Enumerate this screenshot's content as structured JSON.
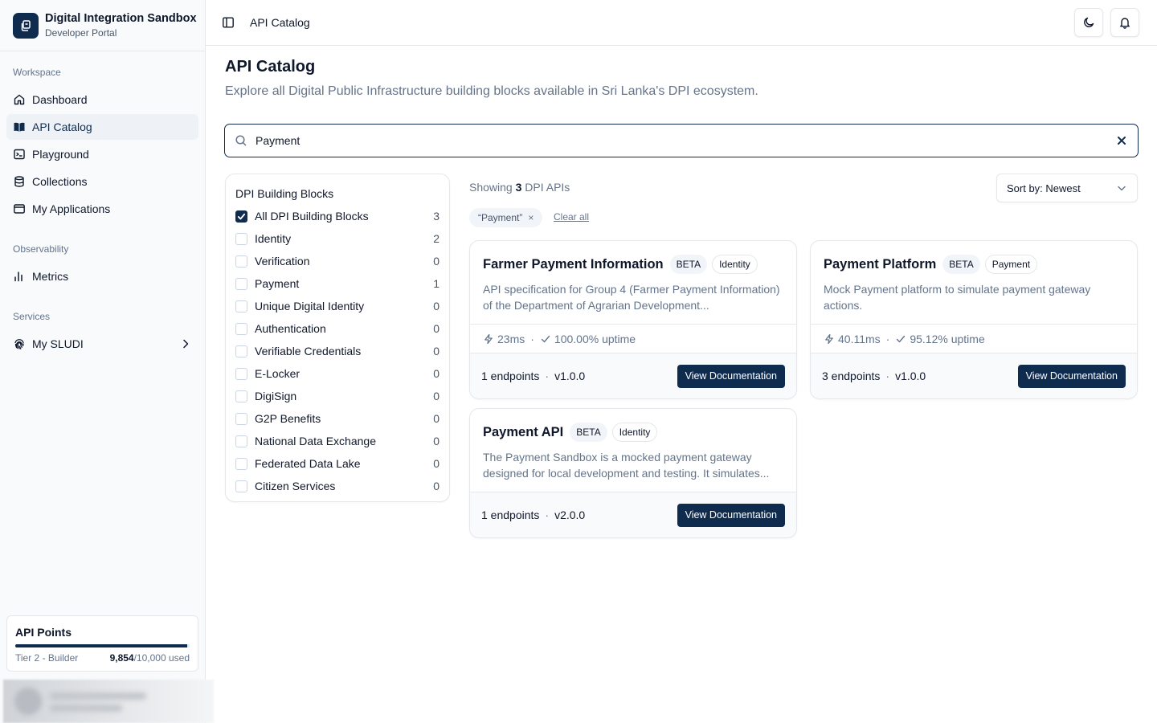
{
  "brand": {
    "title": "Digital Integration Sandbox",
    "subtitle": "Developer Portal"
  },
  "sidebar": {
    "groups": [
      {
        "label": "Workspace",
        "items": [
          {
            "label": "Dashboard",
            "icon": "home-icon"
          },
          {
            "label": "API Catalog",
            "icon": "book-icon",
            "active": true
          },
          {
            "label": "Playground",
            "icon": "terminal-icon"
          },
          {
            "label": "Collections",
            "icon": "database-icon"
          },
          {
            "label": "My Applications",
            "icon": "app-window-icon"
          }
        ]
      },
      {
        "label": "Observability",
        "items": [
          {
            "label": "Metrics",
            "icon": "bar-chart-icon"
          }
        ]
      },
      {
        "label": "Services",
        "items": [
          {
            "label": "My SLUDI",
            "icon": "fingerprint-icon"
          }
        ]
      }
    ],
    "points": {
      "title": "API Points",
      "tier": "Tier 2 - Builder",
      "used": "9,854",
      "total": "/10,000 used",
      "fraction": 0.9854
    }
  },
  "header": {
    "breadcrumb": "API Catalog"
  },
  "main": {
    "title": "API Catalog",
    "description": "Explore all Digital Public Infrastructure building blocks available in Sri Lanka's DPI ecosystem.",
    "search": {
      "value": "Payment"
    },
    "filters": {
      "title": "DPI Building Blocks",
      "items": [
        {
          "label": "All DPI Building Blocks",
          "count": "3",
          "checked": true
        },
        {
          "label": "Identity",
          "count": "2"
        },
        {
          "label": "Verification",
          "count": "0"
        },
        {
          "label": "Payment",
          "count": "1"
        },
        {
          "label": "Unique Digital Identity",
          "count": "0"
        },
        {
          "label": "Authentication",
          "count": "0"
        },
        {
          "label": "Verifiable Credentials",
          "count": "0"
        },
        {
          "label": "E-Locker",
          "count": "0"
        },
        {
          "label": "DigiSign",
          "count": "0"
        },
        {
          "label": "G2P Benefits",
          "count": "0"
        },
        {
          "label": "National Data Exchange",
          "count": "0"
        },
        {
          "label": "Federated Data Lake",
          "count": "0"
        },
        {
          "label": "Citizen Services",
          "count": "0"
        }
      ]
    },
    "results": {
      "prefix": "Showing",
      "count": "3",
      "suffix": "DPI APIs"
    },
    "sort": {
      "label": "Sort by: Newest"
    },
    "active_filter_chip": "“Payment”",
    "chip_remove": "×",
    "clear_all": "Clear all",
    "cards": [
      {
        "name": "Farmer Payment Information",
        "badge": "BETA",
        "category": "Identity",
        "description": "API specification for Group 4 (Farmer Payment Information) of the Department of Agrarian Development...",
        "latency": "23ms",
        "uptime": "100.00% uptime",
        "endpoints": "1 endpoints",
        "version": "v1.0.0",
        "button": "View Documentation"
      },
      {
        "name": "Payment Platform",
        "badge": "BETA",
        "category": "Payment",
        "description": "Mock Payment platform to simulate payment gateway actions.",
        "latency": "40.11ms",
        "uptime": "95.12% uptime",
        "endpoints": "3 endpoints",
        "version": "v1.0.0",
        "button": "View Documentation"
      },
      {
        "name": "Payment API",
        "badge": "BETA",
        "category": "Identity",
        "description": "The Payment Sandbox is a mocked payment gateway designed for local development and testing. It simulates...",
        "endpoints": "1 endpoints",
        "version": "v2.0.0",
        "button": "View Documentation"
      }
    ]
  },
  "colors": {
    "primary": "#0f2c4f",
    "muted": "#64748b",
    "border": "#e5e7eb"
  }
}
